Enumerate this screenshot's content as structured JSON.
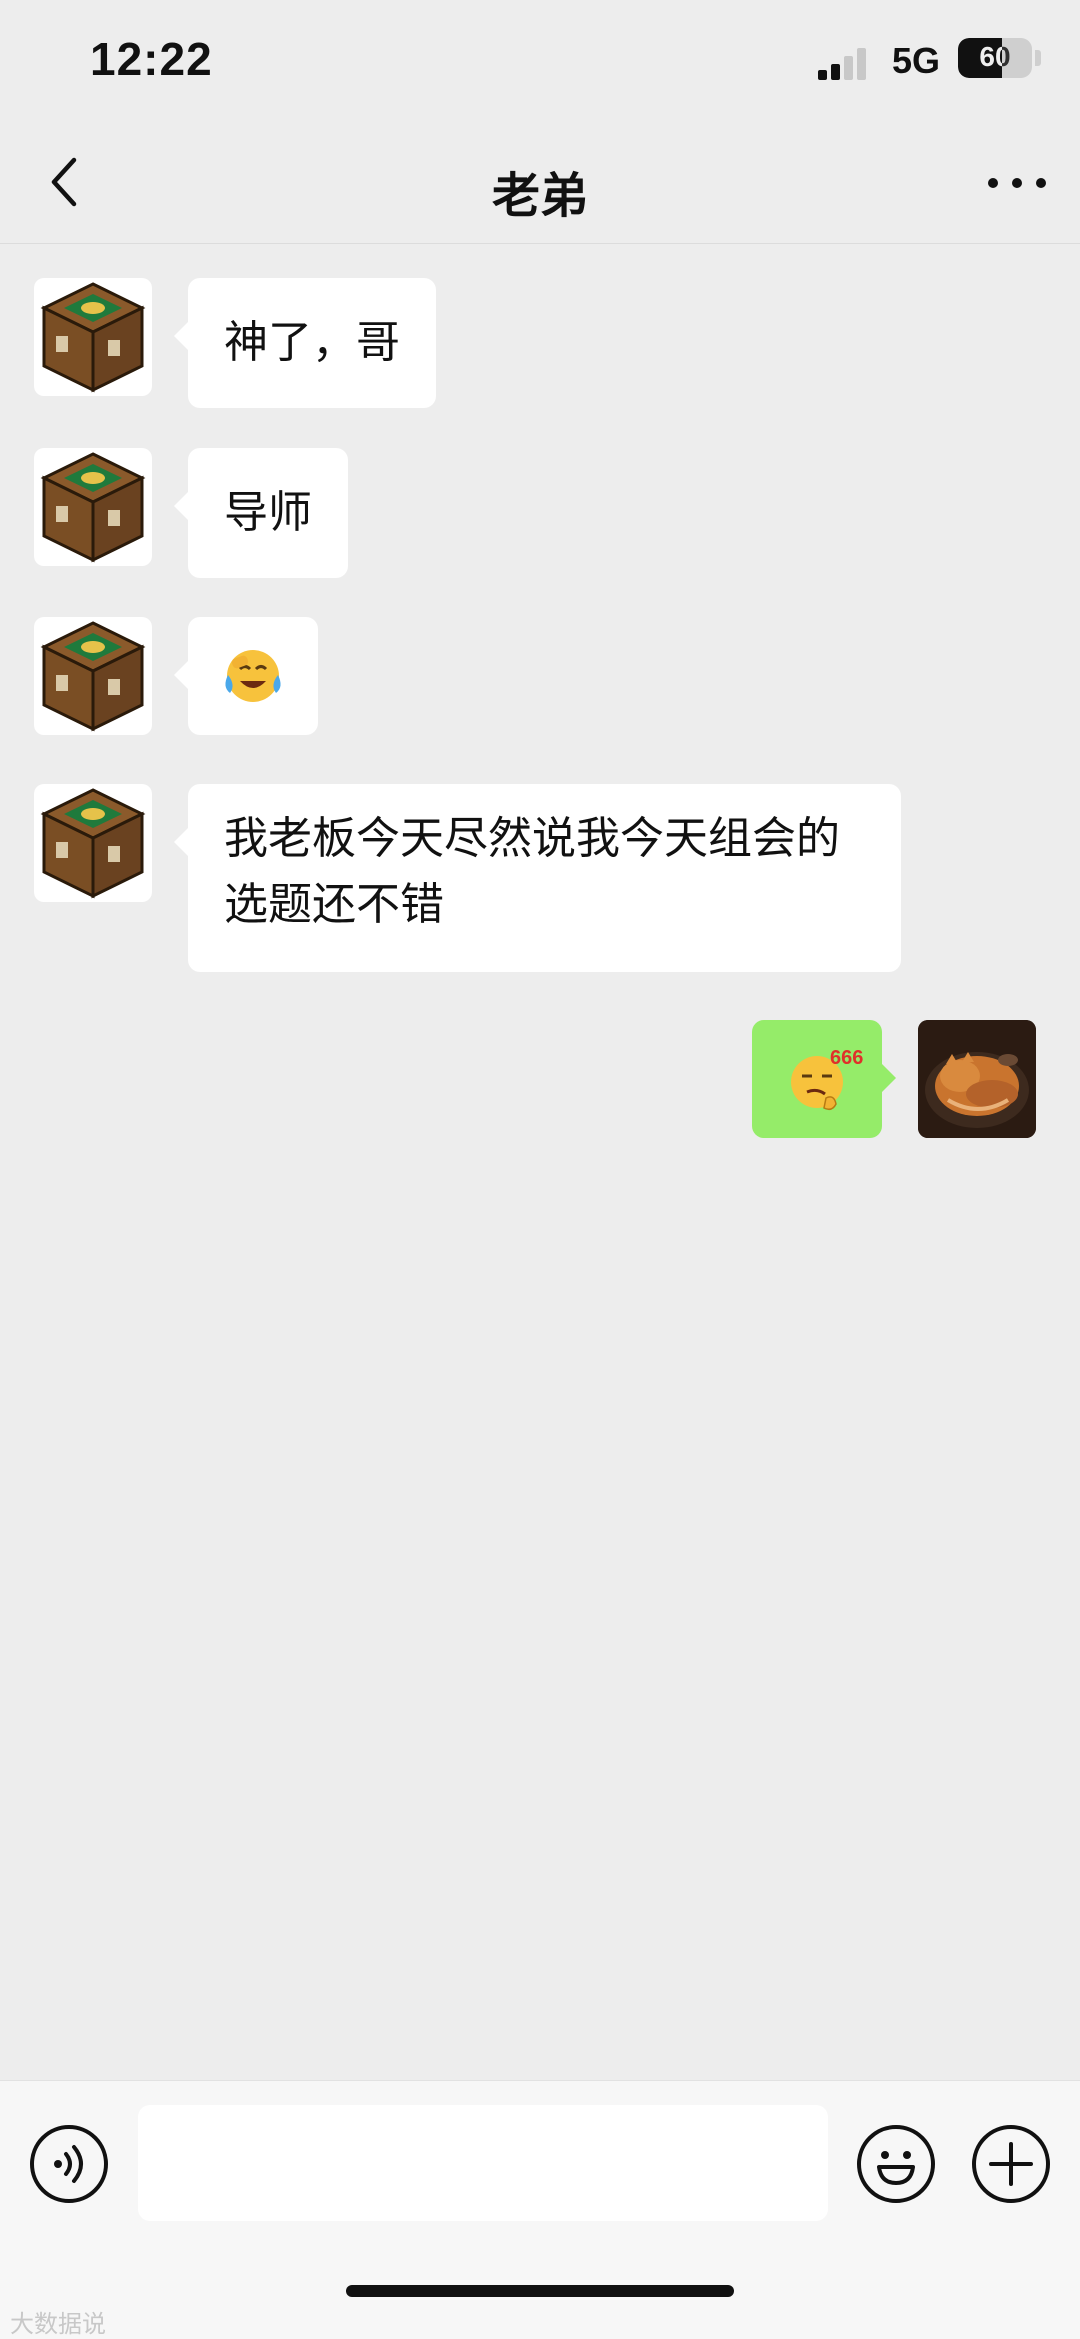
{
  "status_bar": {
    "time": "12:22",
    "network": "5G",
    "battery": "60",
    "battery_level": 0.6
  },
  "nav": {
    "title": "老弟"
  },
  "messages": [
    {
      "side": "in",
      "text": "神了，哥"
    },
    {
      "side": "in",
      "text": "导师"
    },
    {
      "side": "in",
      "emoji": "😭"
    },
    {
      "side": "in",
      "text": "我老板今天尽然说我今天组会的选题还不错"
    },
    {
      "side": "out",
      "sticker_text": "666"
    }
  ],
  "input": {
    "placeholder": ""
  },
  "watermark": "大数据说",
  "colors": {
    "background": "#ededed",
    "incoming_bubble": "#ffffff",
    "outgoing_bubble": "#95ec69"
  },
  "icons": {
    "back": "chevron-left-icon",
    "more": "more-icon",
    "voice": "voice-icon",
    "emoji": "emoji-icon",
    "add": "add-icon"
  }
}
